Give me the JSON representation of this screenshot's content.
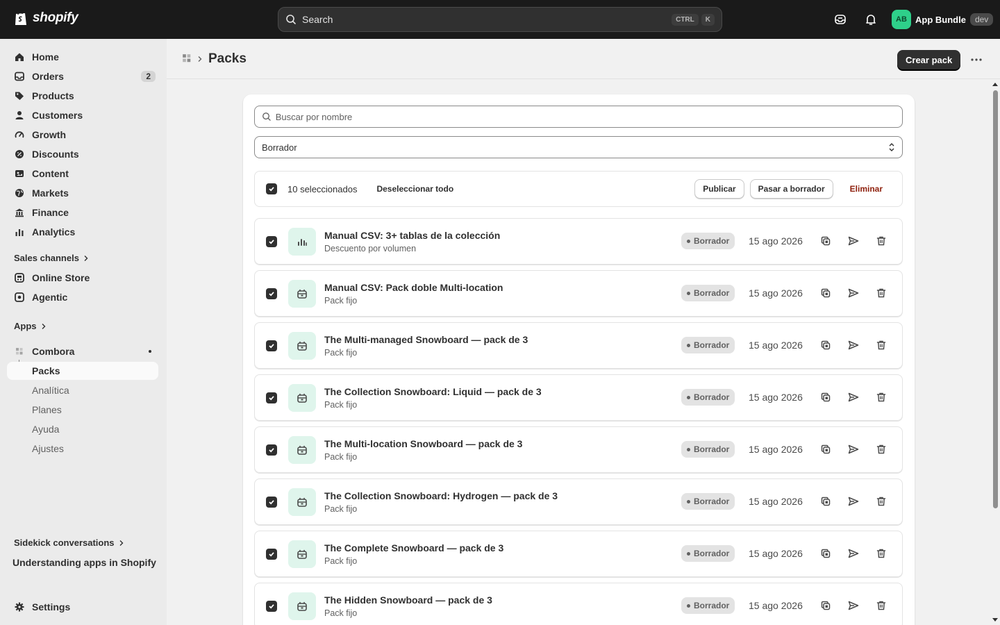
{
  "topbar": {
    "brand": "shopify",
    "search_placeholder": "Search",
    "shortcut_keys": [
      "CTRL",
      "K"
    ],
    "store_initials": "AB",
    "store_name": "App Bundle",
    "env_badge": "dev"
  },
  "sidebar": {
    "nav": [
      {
        "label": "Home",
        "icon": "home-icon"
      },
      {
        "label": "Orders",
        "icon": "inbox-icon",
        "badge": "2"
      },
      {
        "label": "Products",
        "icon": "tag-icon"
      },
      {
        "label": "Customers",
        "icon": "person-icon"
      },
      {
        "label": "Growth",
        "icon": "gauge-icon"
      },
      {
        "label": "Discounts",
        "icon": "discount-icon"
      },
      {
        "label": "Content",
        "icon": "content-icon"
      },
      {
        "label": "Markets",
        "icon": "globe-icon"
      },
      {
        "label": "Finance",
        "icon": "bank-icon"
      },
      {
        "label": "Analytics",
        "icon": "bar-chart-icon"
      }
    ],
    "sales_channels_heading": "Sales channels",
    "channels": [
      {
        "label": "Online Store",
        "icon": "store-icon"
      },
      {
        "label": "Agentic",
        "icon": "agentic-icon"
      }
    ],
    "apps_heading": "Apps",
    "app_name": "Combora",
    "app_pages": [
      "Packs",
      "Analítica",
      "Planes",
      "Ayuda",
      "Ajustes"
    ],
    "sidekick_heading": "Sidekick conversations",
    "sidekick_item": "Understanding apps in Shopify",
    "settings_label": "Settings"
  },
  "page": {
    "title": "Packs",
    "primary_action": "Crear pack",
    "search_placeholder": "Buscar por nombre",
    "status_filter": "Borrador",
    "bulk": {
      "selected_text": "10 seleccionados",
      "deselect_label": "Deseleccionar todo",
      "publish_label": "Publicar",
      "draft_label": "Pasar a borrador",
      "delete_label": "Eliminar"
    },
    "items": [
      {
        "title": "Manual CSV: 3+ tablas de la colección",
        "subtitle": "Descuento por volumen",
        "status": "Borrador",
        "date": "15 ago 2026",
        "icon": "volume-chart-icon"
      },
      {
        "title": "Manual CSV: Pack doble Multi-location",
        "subtitle": "Pack fijo",
        "status": "Borrador",
        "date": "15 ago 2026",
        "icon": "package-icon"
      },
      {
        "title": "The Multi-managed Snowboard — pack de 3",
        "subtitle": "Pack fijo",
        "status": "Borrador",
        "date": "15 ago 2026",
        "icon": "package-icon"
      },
      {
        "title": "The Collection Snowboard: Liquid — pack de 3",
        "subtitle": "Pack fijo",
        "status": "Borrador",
        "date": "15 ago 2026",
        "icon": "package-icon"
      },
      {
        "title": "The Multi-location Snowboard — pack de 3",
        "subtitle": "Pack fijo",
        "status": "Borrador",
        "date": "15 ago 2026",
        "icon": "package-icon"
      },
      {
        "title": "The Collection Snowboard: Hydrogen — pack de 3",
        "subtitle": "Pack fijo",
        "status": "Borrador",
        "date": "15 ago 2026",
        "icon": "package-icon"
      },
      {
        "title": "The Complete Snowboard — pack de 3",
        "subtitle": "Pack fijo",
        "status": "Borrador",
        "date": "15 ago 2026",
        "icon": "package-icon"
      },
      {
        "title": "The Hidden Snowboard — pack de 3",
        "subtitle": "Pack fijo",
        "status": "Borrador",
        "date": "15 ago 2026",
        "icon": "package-icon"
      }
    ]
  },
  "colors": {
    "topbar_bg": "#1a1a1a",
    "sidebar_bg": "#ebebeb",
    "primary_btn": "#303030",
    "thumb_bg": "#dff5ec",
    "danger": "#8e1f0b",
    "avatar": "#2ed08a"
  }
}
